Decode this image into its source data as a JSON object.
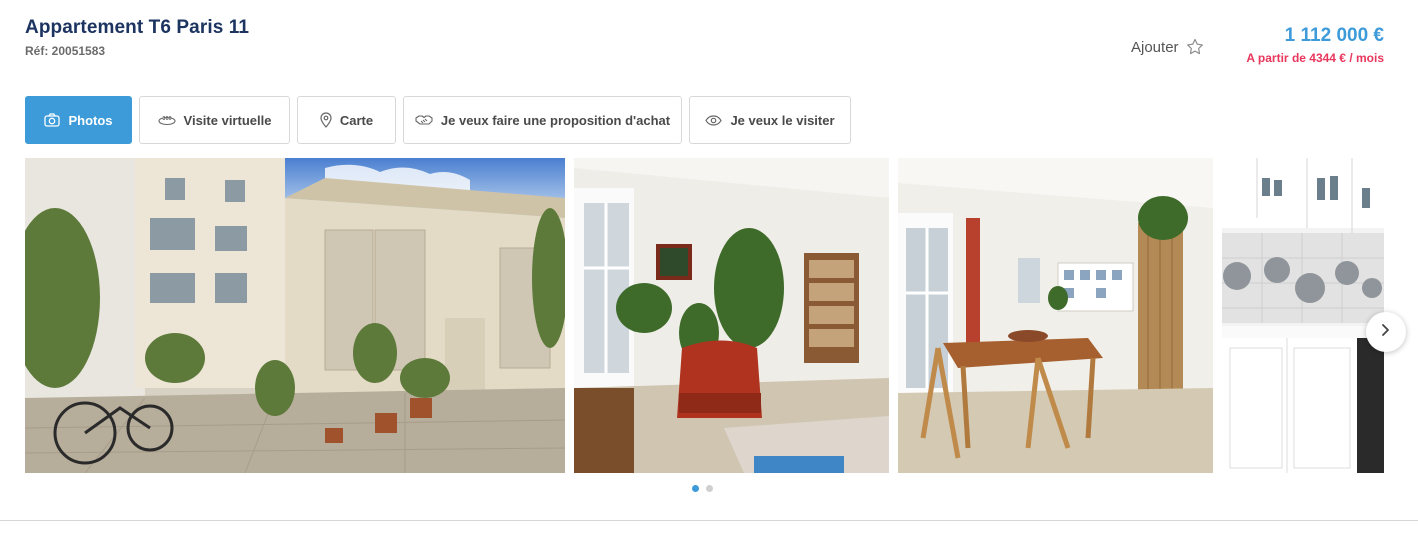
{
  "listing": {
    "title": "Appartement T6 Paris 11",
    "reference": "Réf: 20051583",
    "favorite_label": "Ajouter",
    "price": "1 112 000 €",
    "monthly": "A partir de 4344 € / mois"
  },
  "tabs": [
    {
      "label": "Photos",
      "icon": "camera-icon",
      "active": true
    },
    {
      "label": "Visite virtuelle",
      "icon": "360-icon",
      "active": false
    },
    {
      "label": "Carte",
      "icon": "map-pin-icon",
      "active": false
    },
    {
      "label": "Je veux faire une proposition d'achat",
      "icon": "handshake-icon",
      "active": false
    },
    {
      "label": "Je veux le visiter",
      "icon": "eye-icon",
      "active": false
    }
  ],
  "gallery": {
    "photos": [
      {
        "subject": "courtyard"
      },
      {
        "subject": "living-room"
      },
      {
        "subject": "dining-room"
      },
      {
        "subject": "kitchen"
      }
    ],
    "pagination": {
      "current": 1,
      "total": 2
    }
  },
  "colors": {
    "accent": "#3d9bd9",
    "title": "#1d3461",
    "monthly": "#e8365c"
  }
}
